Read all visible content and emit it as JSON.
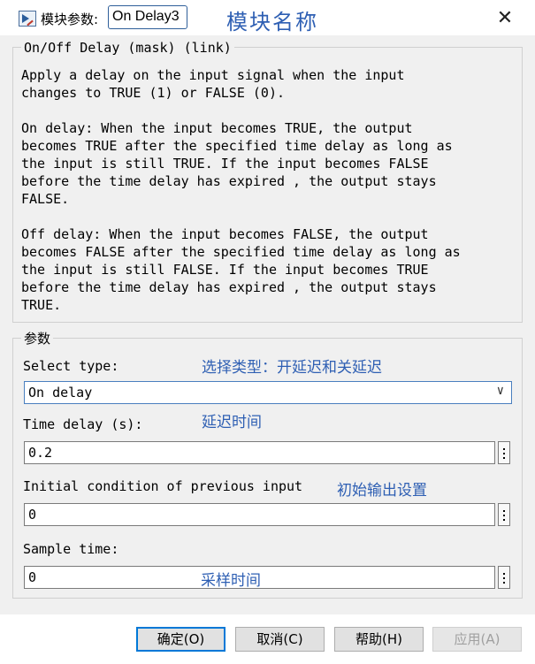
{
  "window": {
    "title_prefix": "模块参数:",
    "block_name": "On Delay3",
    "annotation": "模块名称",
    "close_glyph": "✕"
  },
  "description": {
    "heading": "On/Off Delay  (mask) (link)",
    "lines": [
      "Apply a delay on the input signal when the input",
      "changes to TRUE (1) or FALSE (0).",
      "",
      "On delay: When the input becomes TRUE, the output",
      "becomes TRUE after the specified time delay as long as",
      "the input is still TRUE. If the input becomes FALSE",
      "before the time delay has expired , the output stays",
      "FALSE.",
      "",
      "Off delay: When the input becomes FALSE, the output",
      "becomes FALSE after the specified time delay as long as",
      "the input is still FALSE. If the input becomes TRUE",
      "before the time delay has expired , the output stays",
      "TRUE."
    ]
  },
  "params": {
    "heading": "参数",
    "select_type": {
      "label": "Select type:",
      "value": "On delay",
      "annotation": "选择类型：开延迟和关延迟"
    },
    "time_delay": {
      "label": "Time delay (s):",
      "value": "0.2",
      "annotation": "延迟时间"
    },
    "initial_condition": {
      "label": "Initial condition of previous input",
      "value": "0",
      "annotation": "初始输出设置"
    },
    "sample_time": {
      "label": "Sample time:",
      "value": "0",
      "annotation": "采样时间"
    }
  },
  "buttons": {
    "ok": "确定(O)",
    "cancel": "取消(C)",
    "help": "帮助(H)",
    "apply": "应用(A)"
  },
  "colors": {
    "annotation": "#2e5fb3",
    "focus_border": "#0078d7",
    "panel_bg": "#f0f0f0"
  }
}
